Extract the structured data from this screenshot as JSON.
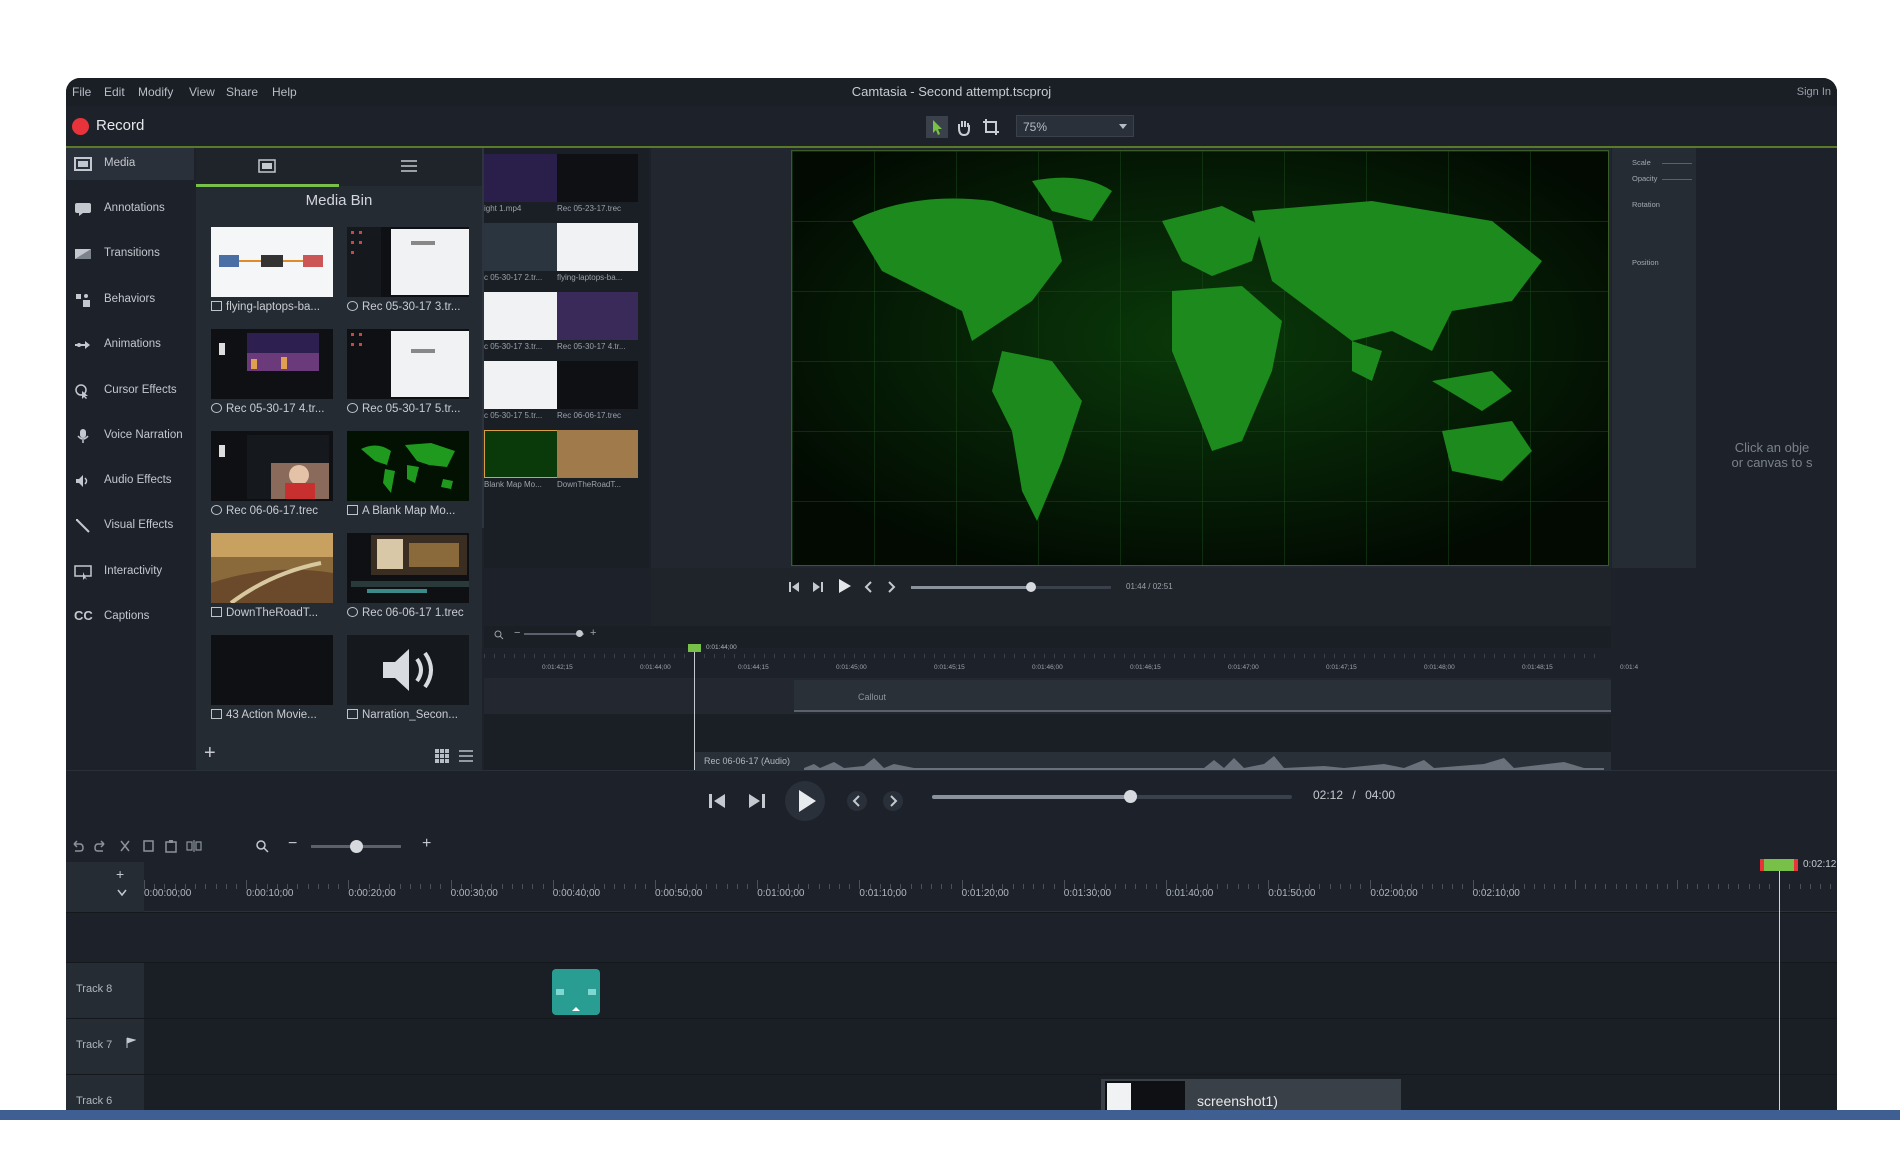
{
  "window": {
    "title": "Camtasia - Second attempt.tscproj",
    "sign_in": "Sign In"
  },
  "menu": [
    "File",
    "Edit",
    "Modify",
    "View",
    "Share",
    "Help"
  ],
  "toolbar": {
    "record_label": "Record",
    "zoom_value": "75%"
  },
  "sidebar": {
    "items": [
      {
        "label": "Media",
        "icon": "film-icon"
      },
      {
        "label": "Annotations",
        "icon": "annotation-icon"
      },
      {
        "label": "Transitions",
        "icon": "transition-icon"
      },
      {
        "label": "Behaviors",
        "icon": "behaviors-icon"
      },
      {
        "label": "Animations",
        "icon": "animation-arrow-icon"
      },
      {
        "label": "Cursor Effects",
        "icon": "cursor-icon"
      },
      {
        "label": "Voice Narration",
        "icon": "microphone-icon"
      },
      {
        "label": "Audio Effects",
        "icon": "speaker-icon"
      },
      {
        "label": "Visual Effects",
        "icon": "wand-icon"
      },
      {
        "label": "Interactivity",
        "icon": "interactivity-icon"
      },
      {
        "label": "Captions",
        "icon": "cc-icon"
      }
    ]
  },
  "media_bin": {
    "title": "Media Bin",
    "items": [
      {
        "label": "flying-laptops-ba...",
        "kind": "video"
      },
      {
        "label": "Rec 05-30-17 3.tr...",
        "kind": "rec"
      },
      {
        "label": "Rec 05-30-17 4.tr...",
        "kind": "rec"
      },
      {
        "label": "Rec 05-30-17 5.tr...",
        "kind": "rec"
      },
      {
        "label": "Rec 06-06-17.trec",
        "kind": "rec"
      },
      {
        "label": "A Blank Map Mo...",
        "kind": "video"
      },
      {
        "label": "DownTheRoadT...",
        "kind": "video"
      },
      {
        "label": "Rec 06-06-17 1.trec",
        "kind": "rec"
      },
      {
        "label": "43 Action Movie...",
        "kind": "video"
      },
      {
        "label": "Narration_Secon...",
        "kind": "audio"
      }
    ]
  },
  "library_thumbs": [
    "ight 1.mp4",
    "Rec 05-23-17.trec",
    "c 05-30-17 2.tr...",
    "flying-laptops-ba...",
    "c 05-30-17 3.tr...",
    "Rec 05-30-17 4.tr...",
    "c 05-30-17 5.tr...",
    "Rec 06-06-17.trec",
    "Blank Map Mo...",
    "DownTheRoadT..."
  ],
  "properties": {
    "scale": "Scale",
    "opacity": "Opacity",
    "rotation": "Rotation",
    "position": "Position"
  },
  "canvas_hint": "Click an obje\nor canvas to s",
  "preview": {
    "time": "01:44 / 02:51",
    "scrub_fraction": 0.6
  },
  "mini_timeline": {
    "ruler": [
      "0:01:42;15",
      "0:01:44;00",
      "0:01:44;15",
      "0:01:45;00",
      "0:01:45;15",
      "0:01:46;00",
      "0:01:46;15",
      "0:01:47;00",
      "0:01:47;15",
      "0:01:48;00",
      "0:01:48;15",
      "0:01:4"
    ],
    "playhead_time": "0:01:44;00",
    "callout": "Callout",
    "audio_clip": "Rec 06-06-17 (Audio)"
  },
  "transport": {
    "current": "02:12",
    "separator": "/",
    "total": "04:00",
    "scrub_fraction": 0.55
  },
  "timeline": {
    "ruler": [
      "0:00:00;00",
      "0:00:10;00",
      "0:00:20;00",
      "0:00:30;00",
      "0:00:40;00",
      "0:00:50;00",
      "0:01:00;00",
      "0:01:10;00",
      "0:01:20;00",
      "0:01:30;00",
      "0:01:40;00",
      "0:01:50;00",
      "0:02:00;00",
      "0:02:10;00"
    ],
    "playhead_time": "0:02:12",
    "zoom_fraction": 0.5,
    "tracks": [
      "Track 8",
      "Track 7",
      "Track 6"
    ],
    "clip_track6": "screenshot1)"
  },
  "colors": {
    "accent_green": "#79c048",
    "record_red": "#e8333a",
    "clip_teal": "#2a9d93"
  }
}
